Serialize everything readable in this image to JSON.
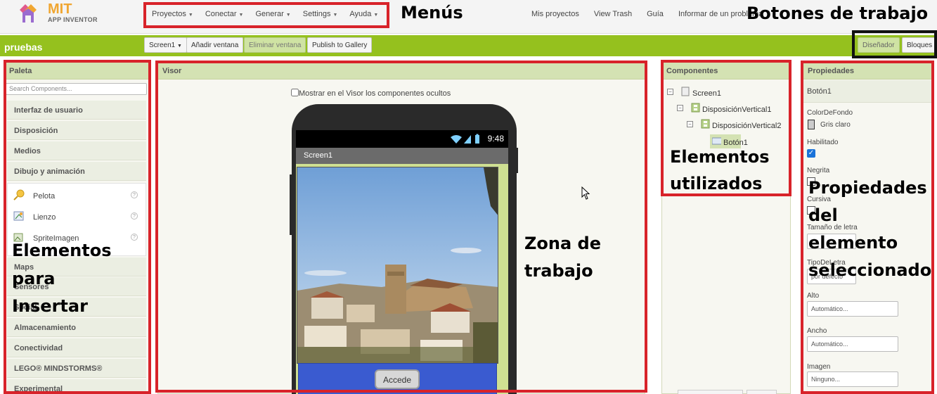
{
  "app": {
    "logo_top": "MIT",
    "logo_bottom": "APP INVENTOR"
  },
  "menus": [
    "Proyectos",
    "Conectar",
    "Generar",
    "Settings",
    "Ayuda"
  ],
  "top_links": [
    "Mis proyectos",
    "View Trash",
    "Guía",
    "Informar de un problema"
  ],
  "project": {
    "name": "pruebas",
    "screen_select": "Screen1",
    "add_screen": "Añadir ventana",
    "remove_screen": "Eliminar ventana",
    "publish": "Publish to Gallery",
    "designer": "Diseñador",
    "blocks": "Bloques"
  },
  "palette": {
    "title": "Paleta",
    "search_placeholder": "Search Components...",
    "categories_top": [
      "Interfaz de usuario",
      "Disposición",
      "Medios",
      "Dibujo y animación"
    ],
    "items": [
      "Pelota",
      "Lienzo",
      "SpriteImagen"
    ],
    "categories_bottom": [
      "Maps",
      "Sensores",
      "Social",
      "Almacenamiento",
      "Conectividad",
      "LEGO® MINDSTORMS®",
      "Experimental"
    ]
  },
  "viewer": {
    "title": "Visor",
    "show_hidden": "Mostrar en el Visor los componentes ocultos",
    "status_time": "9:48",
    "screen_title": "Screen1",
    "button_text": "Accede"
  },
  "components": {
    "title": "Componentes",
    "tree": [
      "Screen1",
      "DisposiciónVertical1",
      "DisposiciónVertical2",
      "Botón1"
    ]
  },
  "properties": {
    "title": "Propiedades",
    "selected": "Botón1",
    "background_label": "ColorDeFondo",
    "background_value": "Gris claro",
    "enabled_label": "Habilitado",
    "bold_label": "Negrita",
    "italic_label": "Cursiva",
    "font_size_label": "Tamaño de letra",
    "font_type_label": "TipoDeLetra",
    "font_type_value": "por defecto",
    "height_label": "Alto",
    "height_value": "Automático...",
    "width_label": "Ancho",
    "width_value": "Automático...",
    "image_label": "Imagen",
    "image_value": "Ninguno..."
  },
  "annotations": {
    "menus": "Menús",
    "work_buttons": "Botones de trabajo",
    "insert_line1": "Elementos",
    "insert_line2": "para",
    "insert_line3": "Insertar",
    "workzone_line1": "Zona de",
    "workzone_line2": "trabajo",
    "used_line1": "Elementos",
    "used_line2": "utilizados",
    "props_line1": "Propiedades",
    "props_line2": "del",
    "props_line3": "elemento",
    "props_line4": "seleccionado"
  },
  "colors": {
    "brand_green": "#95c11e",
    "panel_header": "#d4e2b3",
    "annotation_red": "#d8232a",
    "button_blue": "#3a5bd0"
  }
}
